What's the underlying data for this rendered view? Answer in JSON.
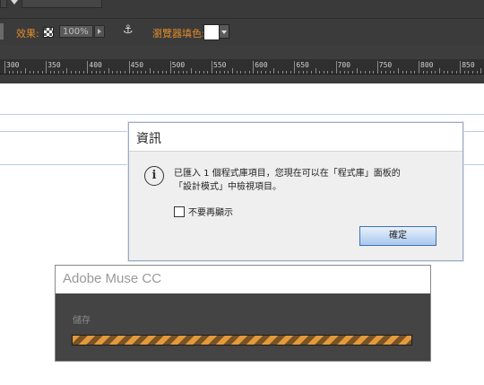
{
  "toolbar": {
    "effects_label": "效果:",
    "opacity_value": "100%",
    "browser_fill_label": "瀏覽器填色:",
    "browser_fill_color": "#ffffff"
  },
  "ruler": {
    "labels": [
      "300",
      "350",
      "400",
      "450",
      "500",
      "550",
      "600",
      "650",
      "700",
      "750",
      "800",
      "850"
    ]
  },
  "info_dialog": {
    "title": "資訊",
    "message_line1": "已匯入 1 個程式庫項目，您現在可以在「程式庫」面板的",
    "message_line2": "「設計模式」中檢視項目。",
    "checkbox_label": "不要再顯示",
    "ok_label": "確定"
  },
  "muse_dialog": {
    "title": "Adobe Muse CC",
    "status": "儲存",
    "progress": 1.0
  },
  "colors": {
    "accent_orange": "#e08b2a",
    "guide_blue": "#b8cdea",
    "progress_stripe": "#e39a3c"
  }
}
